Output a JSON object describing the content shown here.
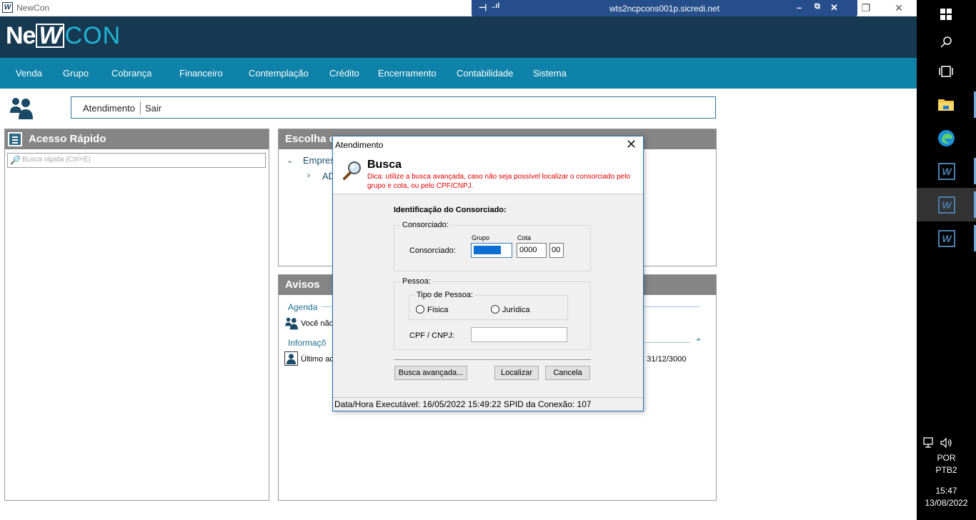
{
  "window": {
    "title": "NewCon",
    "logo_small": "W",
    "minimize": "—",
    "restore": "❐",
    "close": "✕"
  },
  "rdp": {
    "host": "wts2ncpcons001p.sicredi.net",
    "pin": "⊣",
    "signal": "..ıl",
    "minimize": "–",
    "restore": "⧉",
    "close": "✕"
  },
  "app": {
    "logo_ne": "Ne",
    "logo_w": "W",
    "logo_con": "CON"
  },
  "menu": [
    "Venda",
    "Grupo",
    "Cobrança",
    "Financeiro",
    "Contemplação",
    "Crédito",
    "Encerramento",
    "Contabilidade",
    "Sistema"
  ],
  "quickbar": {
    "atendimento": "Atendimento",
    "sair": "Sair"
  },
  "left_panel": {
    "title": "Acesso Rápido",
    "search_placeholder": "Busca rápida (Ctrl+E)"
  },
  "choose_panel": {
    "title": "Escolha o",
    "tree_root": "Empres",
    "tree_child": "AD"
  },
  "avisos_panel": {
    "title": "Avisos",
    "agenda_label": "Agenda",
    "agenda_text": "Você não",
    "info_label": "Informaçõ",
    "last_access": "Último ac",
    "expiry_text": "m: 31/12/3000"
  },
  "dialog": {
    "title": "Atendimento",
    "heading": "Busca",
    "tip": "Dica: utilize a busca avançada, caso não seja possível localizar o consorciado pelo grupo e cota, ou pelo CPF/CNPJ.",
    "ident_title": "Identificação do Consorciado:",
    "consorciado_group": "Consorciado:",
    "grupo_label": "Grupo",
    "cota_label": "Cota",
    "consorciado_field_label": "Consorciado:",
    "grupo_value": "",
    "cota_value": "0000",
    "digito_value": "00",
    "pessoa_group": "Pessoa:",
    "tipo_pessoa_group": "Tipo de Pessoa:",
    "fisica": "Física",
    "juridica": "Jurídica",
    "cpf_label": "CPF / CNPJ:",
    "cpf_value": "",
    "btn_avancada": "Busca avançada...",
    "btn_localizar": "Localizar",
    "btn_cancela": "Cancela",
    "status": "Data/Hora Executável: 16/05/2022  15:49:22 SPID da Conexão: 107"
  },
  "taskbar": {
    "lang1": "POR",
    "lang2": "PTB2",
    "time": "15:47",
    "date": "13/08/2022",
    "nc_glyph": "W"
  }
}
